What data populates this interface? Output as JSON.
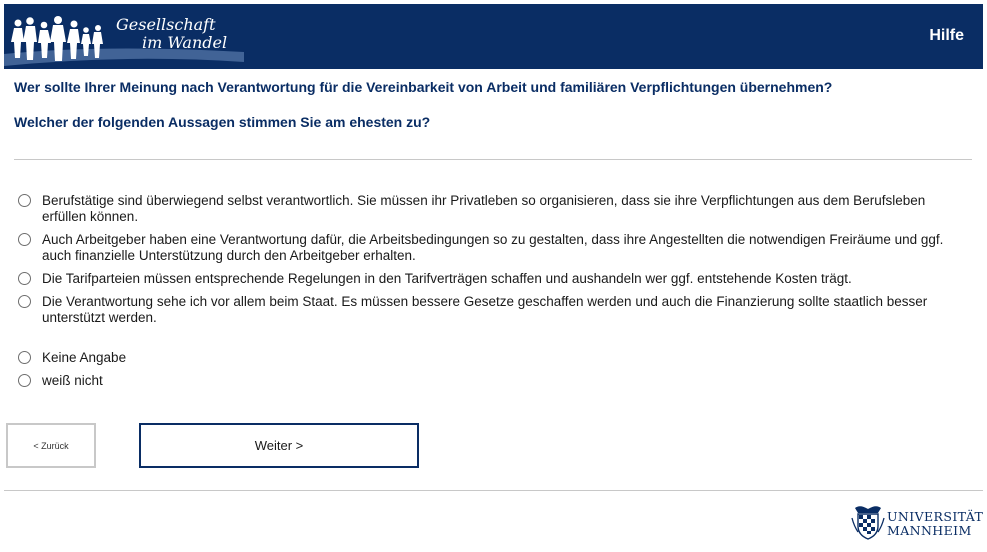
{
  "header": {
    "logo_line1": "Gesellschaft",
    "logo_line2": "im Wandel",
    "help_label": "Hilfe"
  },
  "main": {
    "question": "Wer sollte Ihrer Meinung nach Verantwortung für die Vereinbarkeit von Arbeit und familiären Verpflichtungen übernehmen?",
    "instruction": "Welcher der folgenden Aussagen stimmen Sie am ehesten zu?",
    "options": [
      {
        "label": "Berufstätige sind überwiegend selbst verantwortlich. Sie müssen ihr Privatleben so organisieren, dass sie ihre Verpflichtungen aus dem Berufsleben erfüllen können."
      },
      {
        "label": "Auch Arbeitgeber haben eine Verantwortung dafür, die Arbeitsbedingungen so zu gestalten, dass ihre Angestellten die notwendigen Freiräume und ggf. auch finanzielle Unterstützung durch den Arbeitgeber erhalten."
      },
      {
        "label": "Die Tarifparteien müssen entsprechende Regelungen in den Tarifverträgen schaffen und aushandeln wer ggf. entstehende Kosten trägt."
      },
      {
        "label": "Die Verantwortung sehe ich vor allem beim Staat. Es müssen bessere Gesetze geschaffen werden und auch die Finanzierung sollte staatlich besser unterstützt werden."
      },
      {
        "label": "Keine Angabe"
      },
      {
        "label": "weiß nicht"
      }
    ]
  },
  "nav": {
    "back_label": "< Zurück",
    "next_label": "Weiter >"
  },
  "footer": {
    "university_line1": "UNIVERSITÄT",
    "university_line2": "MANNHEIM"
  },
  "colors": {
    "brand_navy": "#0a2d64",
    "divider": "#c8c8c8"
  },
  "icons": {
    "logo_image": "people-silhouettes-icon",
    "crest": "university-crest-icon",
    "radio": "radio-button-icon"
  }
}
